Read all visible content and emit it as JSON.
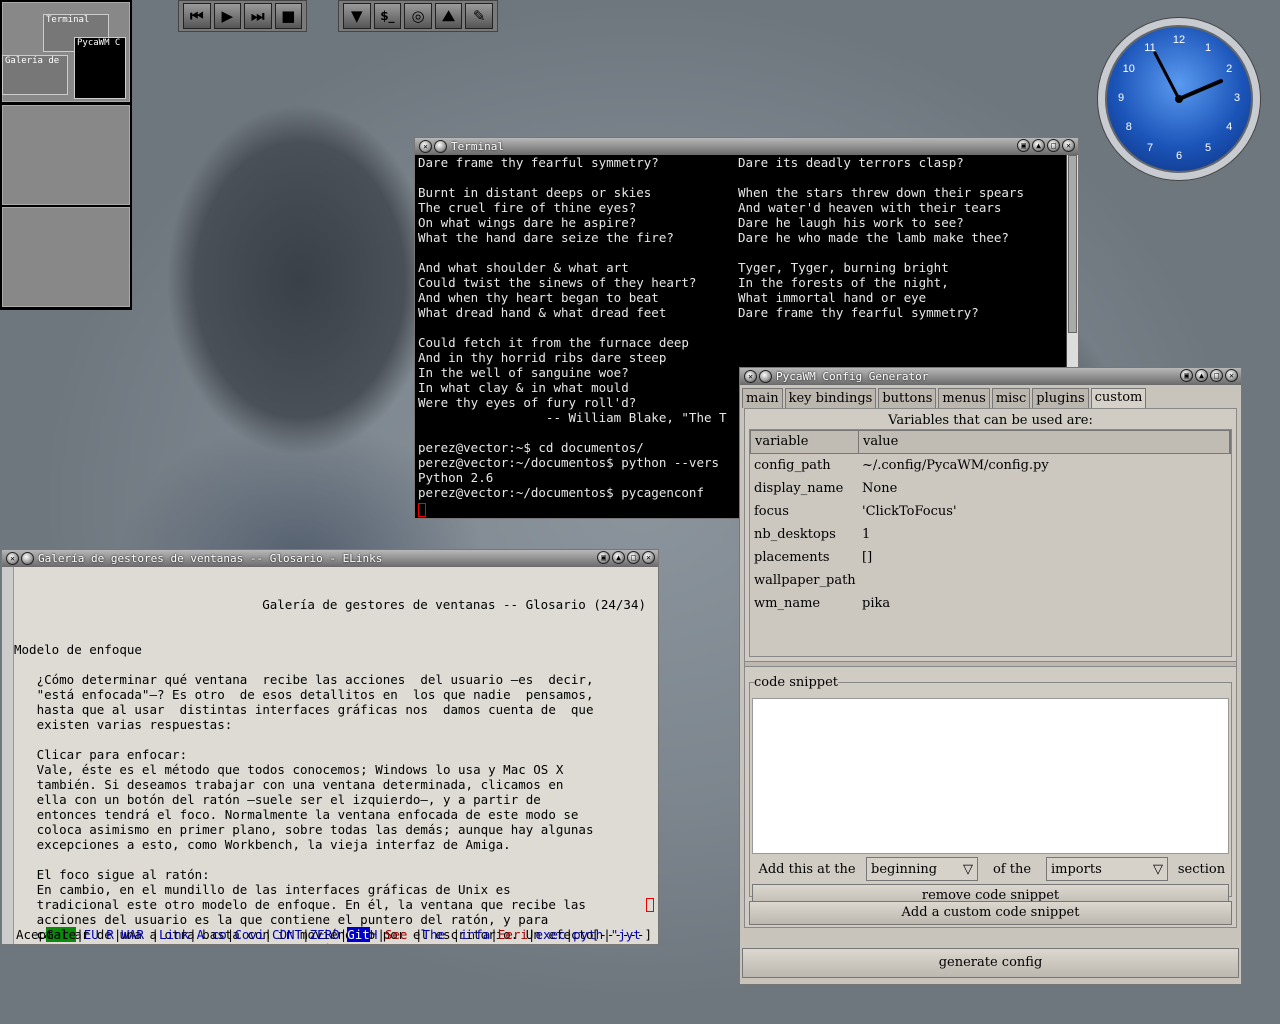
{
  "pager": {
    "windows": [
      "Terminal",
      "PycaWM C",
      "Galería de"
    ]
  },
  "toolbar_media": {
    "buttons": [
      "⏮",
      "▶",
      "⏭",
      "■"
    ]
  },
  "toolbar_apps": {
    "buttons": [
      "▼",
      "$_",
      "◎",
      "⛰",
      "✎"
    ]
  },
  "clock": {
    "numbers": [
      "12",
      "1",
      "2",
      "3",
      "4",
      "5",
      "6",
      "7",
      "8",
      "9",
      "10",
      "11"
    ]
  },
  "terminal": {
    "title": "Terminal",
    "col1": "Dare frame thy fearful symmetry?\n\nBurnt in distant deeps or skies\nThe cruel fire of thine eyes?\nOn what wings dare he aspire?\nWhat the hand dare seize the fire?\n\nAnd what shoulder & what art\nCould twist the sinews of they heart?\nAnd when thy heart began to beat\nWhat dread hand & what dread feet\n\nCould fetch it from the furnace deep\nAnd in thy horrid ribs dare steep\nIn the well of sanguine woe?\nIn what clay & in what mould\nWere thy eyes of fury roll'd?\n                 -- William Blake, \"The T\n\nperez@vector:~$ cd documentos/\nperez@vector:~/documentos$ python --vers\nPython 2.6\nperez@vector:~/documentos$ pycagenconf",
    "col2": "Dare its deadly terrors clasp?\n\nWhen the stars threw down their spears\nAnd water'd heaven with their tears\nDare he laugh his work to see?\nDare he who made the lamb make thee?\n\nTyger, Tyger, burning bright\nIn the forests of the night,\nWhat immortal hand or eye\nDare frame thy fearful symmetry?"
  },
  "elinks": {
    "title": "Galería de gestores de ventanas -- Glosario - ELinks",
    "header": "Galería de gestores de ventanas -- Glosario (24/34)",
    "body": "Modelo de enfoque\n\n   ¿Cómo determinar qué ventana  recibe las acciones  del usuario —es  decir,\n   \"está enfocada\"—? Es otro  de esos detallitos en  los que nadie  pensamos,\n   hasta que al usar  distintas interfaces gráficas nos  damos cuenta de  que\n   existen varias respuestas:\n\n   Clicar para enfocar:\n   Vale, éste es el método que todos conocemos; Windows lo usa y Mac OS X\n   también. Si deseamos trabajar con una ventana determinada, clicamos en\n   ella con un botón del ratón —suele ser el izquierdo—, y a partir de\n   entonces tendrá el foco. Normalmente la ventana enfocada de este modo se\n   coloca asimismo en primer plano, sobre todas las demás; aunque hay algunas\n   excepciones a esto, como Workbench, la vieja interfaz de Amiga.\n\n   El foco sigue al ratón:\n   En cambio, en el mundillo de las interfaces gráficas de Unix es\n   tradicional este otro modelo de enfoque. En él, la ventana que recibe las\n   acciones del usuario es la que contiene el puntero del ratón, y para\n   cambiar de una a otra basta con ir moviéndolo por el escritorio. Un efecto\n   colateral es que si el puntero del ratón no se halla sobre ninguna ventana\n   —ha quedado sobre el fondo del escritorio, por ejemplo—, ninguna de ellas",
    "tabs": [
      "Gale",
      "EU R",
      "WAR ",
      "Link",
      "A co",
      "Covi",
      "CONT",
      "ZERO",
      "Git",
      "H",
      "See ",
      "The ",
      "infa",
      "Eeri",
      "exec",
      "pyth",
      "\"jyt"
    ],
    "status_left": "Aceptar",
    "status_right": "[------]"
  },
  "config": {
    "title": "PycaWM Config Generator",
    "tabs": [
      "main",
      "key bindings",
      "buttons",
      "menus",
      "misc",
      "plugins",
      "custom"
    ],
    "caption": "Variables that can be used are:",
    "col_variable": "variable",
    "col_value": "value",
    "rows": [
      {
        "variable": "config_path",
        "value": "~/.config/PycaWM/config.py"
      },
      {
        "variable": "display_name",
        "value": "None"
      },
      {
        "variable": "focus",
        "value": "'ClickToFocus'"
      },
      {
        "variable": "nb_desktops",
        "value": "1"
      },
      {
        "variable": "placements",
        "value": "[]"
      },
      {
        "variable": "wallpaper_path",
        "value": ""
      },
      {
        "variable": "wm_name",
        "value": "pika"
      }
    ],
    "snippet_label": "code snippet",
    "add_this": "Add this at the",
    "position_value": "beginning",
    "of_the": "of the",
    "section_value": "imports",
    "section_label": "section",
    "remove_button": "remove code snippet",
    "add_button": "Add a custom code snippet",
    "generate_button": "generate config"
  }
}
